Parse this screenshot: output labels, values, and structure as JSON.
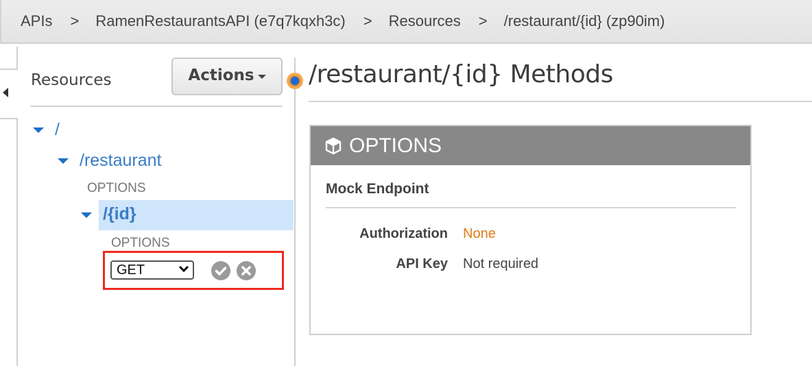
{
  "breadcrumb": [
    {
      "label": "APIs"
    },
    {
      "label": "RamenRestaurantsAPI (e7q7kqxh3c)"
    },
    {
      "label": "Resources"
    },
    {
      "label": "/restaurant/{id} (zp90im)"
    }
  ],
  "breadcrumb_separator": ">",
  "resources_panel": {
    "title": "Resources",
    "actions_label": "Actions",
    "tree": {
      "root": "/",
      "restaurant": {
        "path": "/restaurant",
        "methods": [
          "OPTIONS"
        ]
      },
      "id": {
        "path": "/{id}",
        "selected": true,
        "methods": [
          "OPTIONS"
        ]
      }
    },
    "new_method": {
      "selected_value": "GET",
      "confirm_icon": "check-circle-icon",
      "cancel_icon": "x-circle-icon"
    }
  },
  "main": {
    "title": "/restaurant/{id} Methods",
    "card": {
      "header_icon": "cube-icon",
      "header": "OPTIONS",
      "subtitle": "Mock Endpoint",
      "rows": [
        {
          "label": "Authorization",
          "value": "None",
          "value_color": "#e07a17"
        },
        {
          "label": "API Key",
          "value": "Not required"
        }
      ]
    }
  },
  "colors": {
    "link_blue": "#3a7cc4",
    "selected_row": "#cfe5fb",
    "highlight_box": "#ee2a1e",
    "card_header": "#888888"
  }
}
